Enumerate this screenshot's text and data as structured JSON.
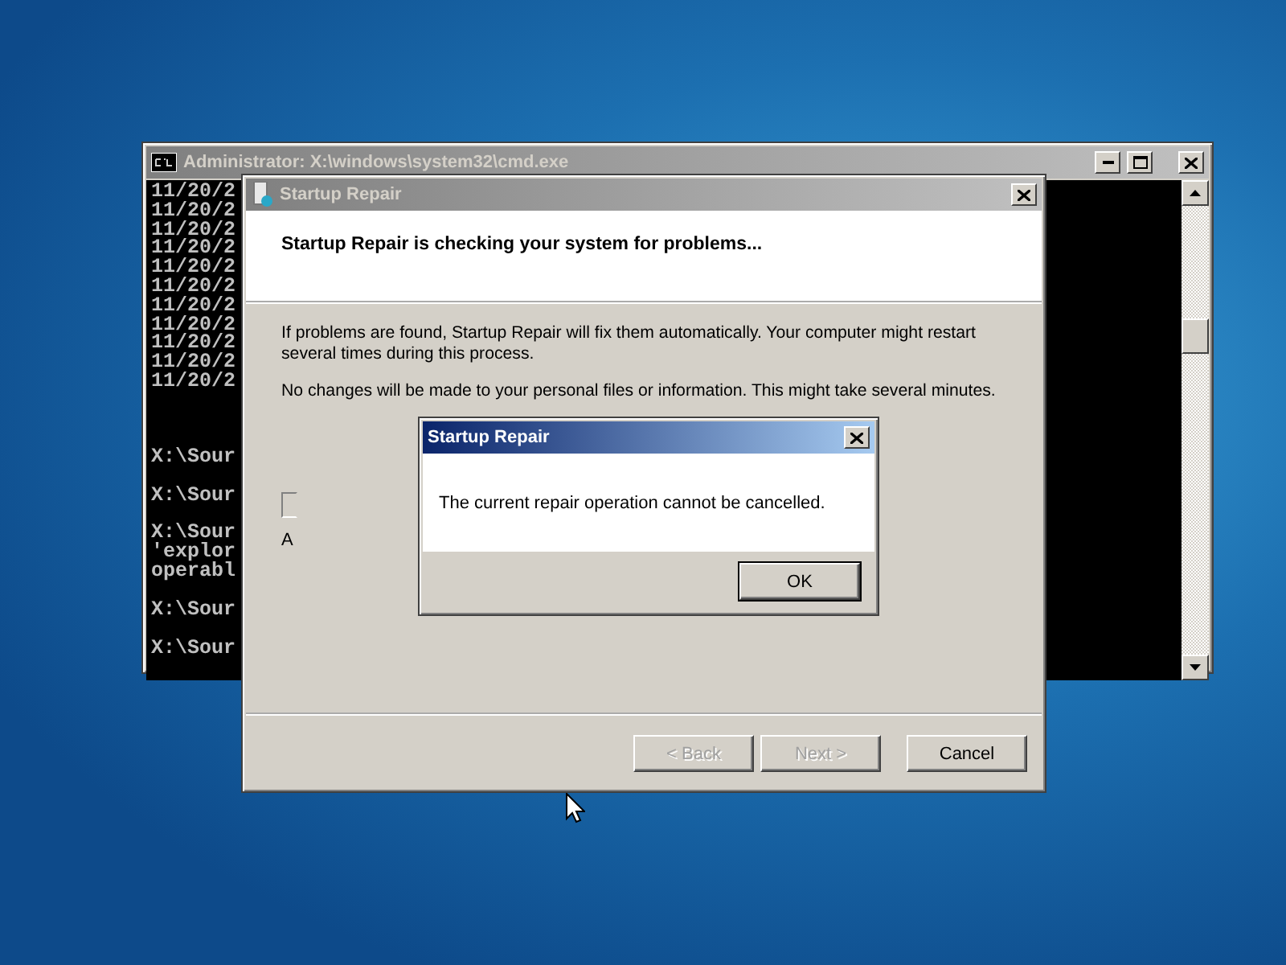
{
  "console_window": {
    "title": "Administrator: X:\\windows\\system32\\cmd.exe",
    "blocks": [
      {
        "kind": "output",
        "lines": [
          "11/20/2",
          "11/20/2",
          "11/20/2",
          "11/20/2",
          "11/20/2",
          "11/20/2",
          "11/20/2",
          "11/20/2",
          "11/20/2",
          "11/20/2",
          "11/20/2"
        ]
      },
      {
        "kind": "prompt",
        "lines": [
          "X:\\Sour"
        ]
      },
      {
        "kind": "prompt",
        "lines": [
          "X:\\Sour"
        ]
      },
      {
        "kind": "prompt",
        "lines": [
          "X:\\Sour",
          "'explor",
          "operabl"
        ]
      },
      {
        "kind": "prompt",
        "lines": [
          "X:\\Sour"
        ]
      },
      {
        "kind": "prompt",
        "lines": [
          "X:\\Sour"
        ]
      }
    ]
  },
  "repair_window": {
    "title": "Startup Repair",
    "heading": "Startup Repair is checking your system for problems...",
    "paragraphs": [
      "If problems are found, Startup Repair will fix them automatically. Your computer might restart several times during this process.",
      "No changes will be made to your personal files or information. This might take several minutes."
    ],
    "status_text": "A",
    "buttons": [
      {
        "label": "< Back",
        "disabled": true
      },
      {
        "label": "Next >",
        "disabled": true
      },
      {
        "label": "Cancel",
        "disabled": false
      }
    ]
  },
  "message_box": {
    "title": "Startup Repair",
    "message": "The current repair operation cannot be cancelled.",
    "button": "OK"
  }
}
